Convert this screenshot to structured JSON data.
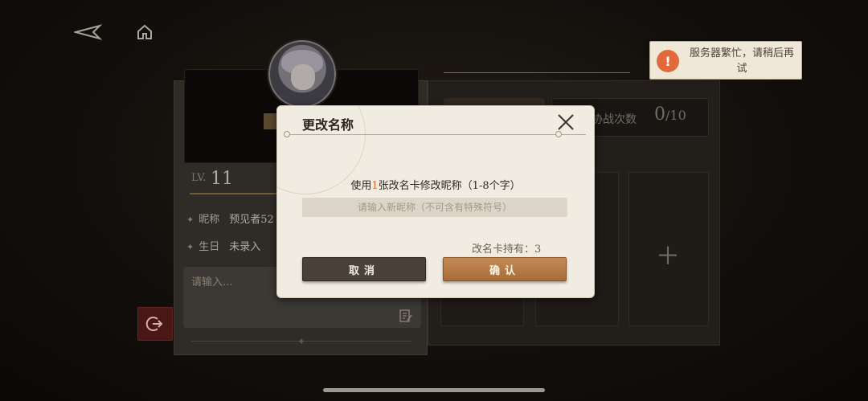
{
  "nav": {
    "back_icon": "back-arrow-icon",
    "home_icon": "home-icon"
  },
  "profile": {
    "level_prefix": "LV.",
    "level": "11",
    "nickname_label": "昵称",
    "nickname_value": "预见者52",
    "birthday_label": "生日",
    "birthday_value": "未录入",
    "signature_placeholder": "请输入..."
  },
  "stats": {
    "label": "协战次数",
    "value": "0",
    "max": "/10"
  },
  "toast": {
    "icon": "warning-icon",
    "text": "服务器繁忙，请稍后再试"
  },
  "dialog": {
    "title": "更改名称",
    "desc_prefix": "使用",
    "desc_count": "1",
    "desc_suffix": "张改名卡修改昵称（1-8个字）",
    "input_placeholder": "请输入新昵称（不可含有特殊符号）",
    "card_count_text": "改名卡持有：3",
    "cancel_label": "取消",
    "confirm_label": "确认"
  },
  "colors": {
    "accent": "#d2672c",
    "confirm": "#b57842",
    "cancel": "#4a4238"
  }
}
